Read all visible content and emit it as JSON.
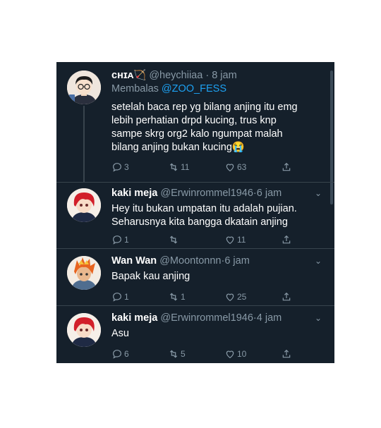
{
  "tweets": [
    {
      "display_name": "ᴄʜɪᴀ",
      "name_emoji": "🏹",
      "handle": "@heychiiaa",
      "time": "8 jam",
      "reply_prefix": "Membalas",
      "reply_mention": "@ZOO_FESS",
      "text": "setelah baca rep yg bilang anjing itu emg\nlebih perhatian drpd kucing, trus knp\nsampe skrg org2 kalo ngumpat malah\nbilang anjing bukan kucing😭",
      "replies": "3",
      "retweets": "11",
      "likes": "63"
    },
    {
      "display_name": "kaki meja",
      "handle": "@Erwinrommel1946",
      "time": "6 jam",
      "text": "Hey itu bukan umpatan itu adalah pujian.\nSeharusnya kita bangga dkatain anjing",
      "replies": "1",
      "retweets": "",
      "likes": "11"
    },
    {
      "display_name": "Wan Wan",
      "handle": "@Moontonnn",
      "time": "6 jam",
      "text": "Bapak kau anjing",
      "replies": "1",
      "retweets": "1",
      "likes": "25"
    },
    {
      "display_name": "kaki meja",
      "handle": "@Erwinrommel1946",
      "time": "4 jam",
      "text": "Asu",
      "replies": "6",
      "retweets": "5",
      "likes": "10"
    }
  ],
  "separator": "·",
  "colors": {
    "background": "#15202b",
    "secondary_text": "#8899a6",
    "mention": "#1da1f2",
    "divider": "#38444d"
  },
  "icons": [
    "reply-icon",
    "retweet-icon",
    "like-icon",
    "share-icon",
    "chevron-down-icon"
  ]
}
